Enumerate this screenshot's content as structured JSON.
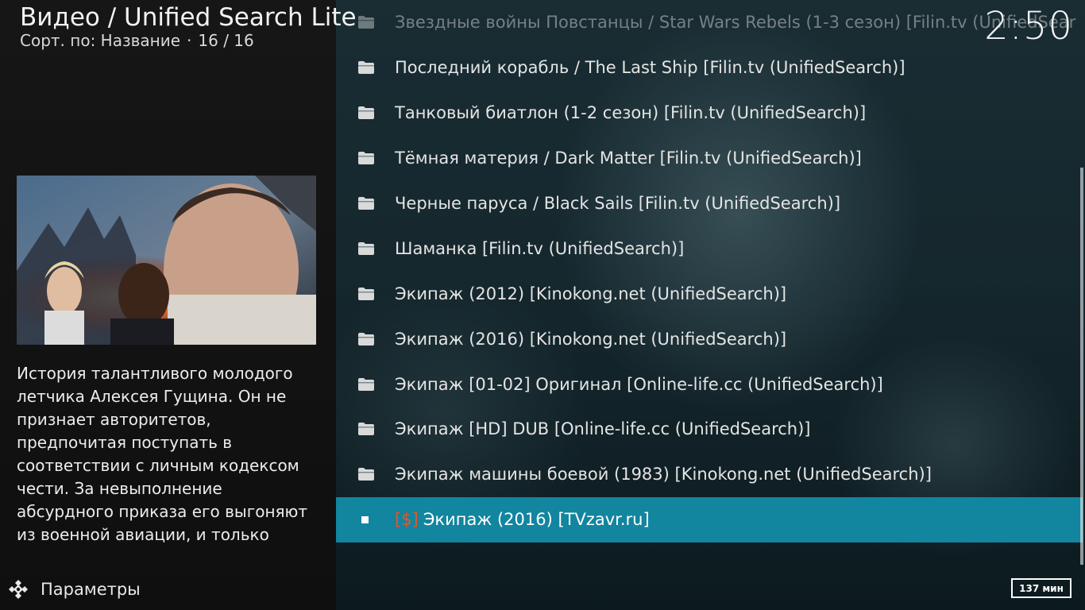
{
  "header": {
    "title": "Видео / Unified Search Lite",
    "sort_label": "Сорт. по: Название",
    "separator": "·",
    "position": "16 / 16"
  },
  "clock": "2:50",
  "plot": "История талантливого молодого летчика Алексея Гущина. Он не признает авторитетов, предпочитая поступать в соответствии с личным кодексом чести. За невыполнение абсурдного приказа его выгоняют из военной авиации, и только",
  "settings": {
    "label": "Параметры",
    "icon": "settings-gear-icon"
  },
  "list": {
    "items": [
      {
        "label": "Звездные войны Повстанцы / Star Wars Rebels (1-3 сезон) [Filin.tv (UnifiedSear",
        "icon": "folder-icon",
        "state": "faded"
      },
      {
        "label": "Последний корабль / The Last Ship [Filin.tv (UnifiedSearch)]",
        "icon": "folder-icon"
      },
      {
        "label": "Танковый биатлон (1-2 сезон) [Filin.tv (UnifiedSearch)]",
        "icon": "folder-icon"
      },
      {
        "label": "Тёмная материя / Dark Matter [Filin.tv (UnifiedSearch)]",
        "icon": "folder-icon"
      },
      {
        "label": "Черные паруса / Black Sails [Filin.tv (UnifiedSearch)]",
        "icon": "folder-icon"
      },
      {
        "label": "Шаманка [Filin.tv (UnifiedSearch)]",
        "icon": "folder-icon"
      },
      {
        "label": "Экипаж (2012) [Kinokong.net (UnifiedSearch)]",
        "icon": "folder-icon"
      },
      {
        "label": "Экипаж (2016) [Kinokong.net (UnifiedSearch)]",
        "icon": "folder-icon"
      },
      {
        "label": "Экипаж [01-02] Оригинал [Online-life.cc (UnifiedSearch)]",
        "icon": "folder-icon"
      },
      {
        "label": "Экипаж [HD] DUB [Online-life.cc (UnifiedSearch)]",
        "icon": "folder-icon"
      },
      {
        "label": "Экипаж машины боевой (1983) [Kinokong.net (UnifiedSearch)]",
        "icon": "folder-icon"
      },
      {
        "tag": "[$]",
        "label": "Экипаж (2016) [TVzavr.ru]",
        "icon": "bullet-icon",
        "state": "selected"
      }
    ]
  },
  "duration": "137 мин",
  "colors": {
    "selection": "#12859f",
    "tag": "#e2572d"
  }
}
